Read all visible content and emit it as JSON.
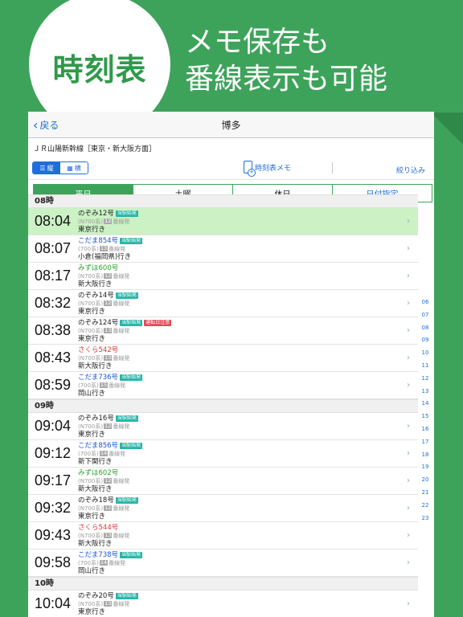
{
  "hero": {
    "badge": "時刻表",
    "line1": "メモ保存も",
    "line2": "番線表示も可能"
  },
  "nav": {
    "back_label": "戻る",
    "title": "博多"
  },
  "line_name": "ＪＲ山陽新幹線［東京・新大阪方面］",
  "toolbar": {
    "vertical_label": "縦",
    "horizontal_label": "横",
    "memo_label": "時刻表メモ",
    "filter_label": "絞り込み"
  },
  "day_tabs": [
    "平日",
    "土曜",
    "休日",
    "日付指定"
  ],
  "hours": [
    {
      "label": "08時",
      "rows": [
        {
          "time": "08:04",
          "train": "のぞみ12号",
          "color": "dark",
          "badge": "当駅始発",
          "badge2": "",
          "car": "(N700系)",
          "track": "12",
          "track_suffix": "番線発",
          "dest": "東京行き",
          "highlight": true
        },
        {
          "time": "08:07",
          "train": "こだま854号",
          "color": "blue",
          "badge": "当駅始発",
          "badge2": "",
          "car": "(700系)",
          "track": "13",
          "track_suffix": "番線発",
          "dest": "小倉(福岡県)行き",
          "highlight": false
        },
        {
          "time": "08:17",
          "train": "みずほ600号",
          "color": "green",
          "badge": "",
          "badge2": "",
          "car": "(N700系)",
          "track": "12",
          "track_suffix": "番線発",
          "dest": "新大阪行き",
          "highlight": false
        },
        {
          "time": "08:32",
          "train": "のぞみ14号",
          "color": "dark",
          "badge": "当駅始発",
          "badge2": "",
          "car": "(N700系)",
          "track": "12",
          "track_suffix": "番線発",
          "dest": "東京行き",
          "highlight": false
        },
        {
          "time": "08:38",
          "train": "のぞみ124号",
          "color": "dark",
          "badge": "当駅始発",
          "badge2": "運転日注意",
          "car": "(N700系)",
          "track": "13",
          "track_suffix": "番線発",
          "dest": "東京行き",
          "highlight": false
        },
        {
          "time": "08:43",
          "train": "さくら542号",
          "color": "red",
          "badge": "",
          "badge2": "",
          "car": "(N700系)",
          "track": "13",
          "track_suffix": "番線発",
          "dest": "新大阪行き",
          "highlight": false
        },
        {
          "time": "08:59",
          "train": "こだま736号",
          "color": "blue",
          "badge": "当駅始発",
          "badge2": "",
          "car": "(700系)",
          "track": "15",
          "track_suffix": "番線発",
          "dest": "岡山行き",
          "highlight": false
        }
      ]
    },
    {
      "label": "09時",
      "rows": [
        {
          "time": "09:04",
          "train": "のぞみ16号",
          "color": "dark",
          "badge": "当駅始発",
          "badge2": "",
          "car": "(N700系)",
          "track": "12",
          "track_suffix": "番線発",
          "dest": "東京行き",
          "highlight": false
        },
        {
          "time": "09:12",
          "train": "こだま856号",
          "color": "blue",
          "badge": "当駅始発",
          "badge2": "",
          "car": "(700系)",
          "track": "14",
          "track_suffix": "番線発",
          "dest": "新下関行き",
          "highlight": false
        },
        {
          "time": "09:17",
          "train": "みずほ602号",
          "color": "green",
          "badge": "",
          "badge2": "",
          "car": "(N700系)",
          "track": "12",
          "track_suffix": "番線発",
          "dest": "新大阪行き",
          "highlight": false
        },
        {
          "time": "09:32",
          "train": "のぞみ18号",
          "color": "dark",
          "badge": "当駅始発",
          "badge2": "",
          "car": "(N700系)",
          "track": "12",
          "track_suffix": "番線発",
          "dest": "東京行き",
          "highlight": false
        },
        {
          "time": "09:43",
          "train": "さくら544号",
          "color": "red",
          "badge": "",
          "badge2": "",
          "car": "(N700系)",
          "track": "13",
          "track_suffix": "番線発",
          "dest": "新大阪行き",
          "highlight": false
        },
        {
          "time": "09:58",
          "train": "こだま738号",
          "color": "blue",
          "badge": "当駅始発",
          "badge2": "",
          "car": "(700系)",
          "track": "14",
          "track_suffix": "番線発",
          "dest": "岡山行き",
          "highlight": false
        }
      ]
    },
    {
      "label": "10時",
      "rows": [
        {
          "time": "10:04",
          "train": "のぞみ20号",
          "color": "dark",
          "badge": "当駅始発",
          "badge2": "",
          "car": "(N700系)",
          "track": "13",
          "track_suffix": "番線発",
          "dest": "東京行き",
          "highlight": false
        }
      ]
    }
  ],
  "index": [
    "06",
    "07",
    "08",
    "09",
    "10",
    "11",
    "12",
    "13",
    "14",
    "15",
    "16",
    "17",
    "18",
    "19",
    "20",
    "21",
    "22",
    "23"
  ],
  "colors": {
    "brand_green": "#3ea35a",
    "link_blue": "#1e6fd9",
    "highlight": "#ccf1c5"
  }
}
